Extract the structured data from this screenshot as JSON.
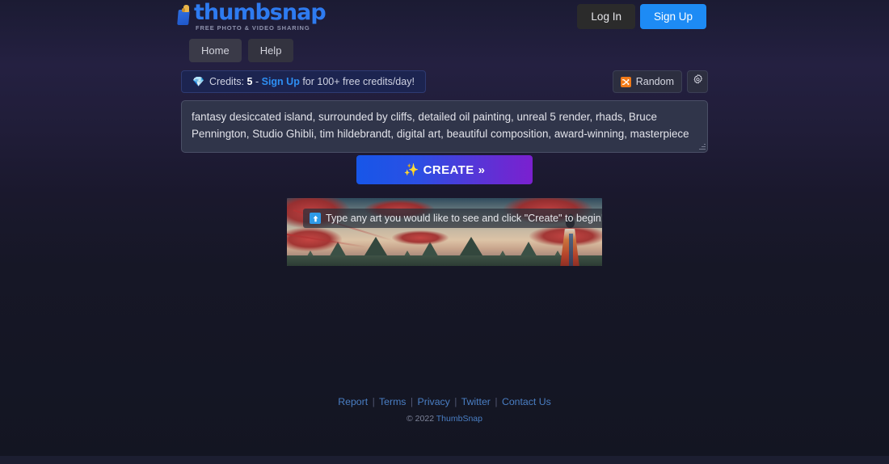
{
  "brand": {
    "name": "thumbsnap",
    "tagline": "FREE PHOTO & VIDEO SHARING",
    "logo_icon": "thumbs-up-icon",
    "accent_color": "#2e7bf0"
  },
  "header": {
    "login_label": "Log In",
    "signup_label": "Sign Up",
    "signup_color": "#1d8bf5"
  },
  "nav": {
    "tabs": [
      {
        "label": "Home",
        "active": true
      },
      {
        "label": "Help",
        "active": false
      }
    ]
  },
  "credits": {
    "gem_icon": "gem-icon",
    "gem_glyph": "💎",
    "prefix": "Credits:",
    "amount": "5",
    "dash": "-",
    "link_label": "Sign Up",
    "suffix": "for 100+ free credits/day!"
  },
  "controls": {
    "random_label": "Random",
    "random_icon": "shuffle-icon",
    "random_icon_color": "#f07a18",
    "settings_icon": "gear-icon"
  },
  "prompt": {
    "value": "fantasy desiccated island, surrounded by cliffs, detailed oil painting, unreal 5 render, rhads, Bruce Pennington, Studio Ghibli, tim hildebrandt, digital art, beautiful composition, award-winning, masterpiece",
    "placeholder": "Type any art you would like to see..."
  },
  "create": {
    "icon": "sparkles-icon",
    "icon_glyph": "✨",
    "label": "CREATE",
    "chevron": "»",
    "gradient_from": "#1756e8",
    "gradient_to": "#7b20cf"
  },
  "preview": {
    "hint_icon": "up-arrow-icon",
    "hint_glyph": "⬆",
    "hint_text": "Type any art you would like to see and click \"Create\" to begin!",
    "alt": "fantasy landscape with red foliage, mountains and a robed figure"
  },
  "footer": {
    "links": [
      {
        "label": "Report"
      },
      {
        "label": "Terms"
      },
      {
        "label": "Privacy"
      },
      {
        "label": "Twitter"
      },
      {
        "label": "Contact Us"
      }
    ],
    "separator": "|",
    "copyright_prefix": "© 2022",
    "copyright_brand": "ThumbSnap"
  }
}
